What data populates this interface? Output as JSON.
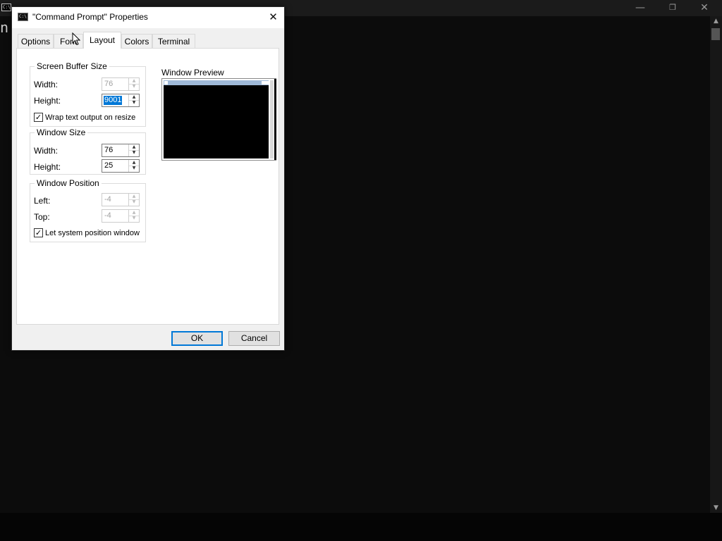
{
  "console": {
    "icon_text": "C:\\",
    "visible_text": "n",
    "minimize_glyph": "—",
    "maximize_glyph": "❐",
    "close_glyph": "✕"
  },
  "dialog": {
    "icon_text": "C:\\",
    "title": "\"Command Prompt\" Properties",
    "close_glyph": "✕",
    "tabs": [
      {
        "label": "Options"
      },
      {
        "label": "Font"
      },
      {
        "label": "Layout"
      },
      {
        "label": "Colors"
      },
      {
        "label": "Terminal"
      }
    ],
    "active_tab": "Layout",
    "screen_buffer": {
      "title": "Screen Buffer Size",
      "width_label": "Width:",
      "width_value": "76",
      "height_label": "Height:",
      "height_value": "9001",
      "wrap_label": "Wrap text output on resize",
      "wrap_checked": true
    },
    "window_size": {
      "title": "Window Size",
      "width_label": "Width:",
      "width_value": "76",
      "height_label": "Height:",
      "height_value": "25"
    },
    "window_position": {
      "title": "Window Position",
      "left_label": "Left:",
      "left_value": "-4",
      "top_label": "Top:",
      "top_value": "-4",
      "let_system_label": "Let system position window",
      "let_system_checked": true
    },
    "preview": {
      "label": "Window Preview"
    },
    "buttons": {
      "ok": "OK",
      "cancel": "Cancel"
    },
    "spin_up_glyph": "▲",
    "spin_down_glyph": "▼",
    "check_glyph": "✓"
  }
}
